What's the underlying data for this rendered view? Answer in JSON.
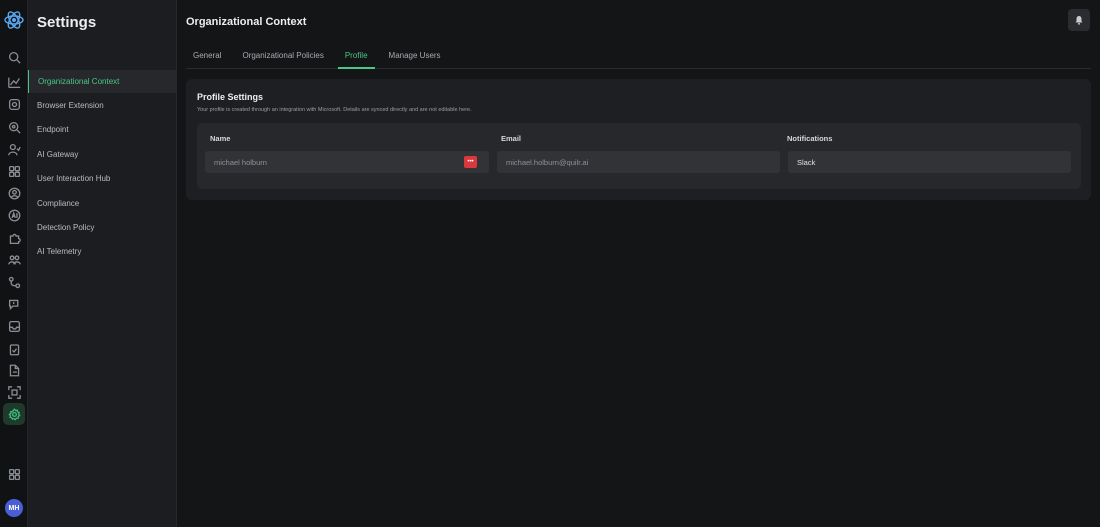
{
  "rail": {
    "avatar_initials": "MH",
    "accent_color": "#3fbf7a"
  },
  "sidebar": {
    "title": "Settings",
    "items": [
      {
        "label": "Organizational Context",
        "active": true
      },
      {
        "label": "Browser Extension"
      },
      {
        "label": "Endpoint"
      },
      {
        "label": "AI Gateway"
      },
      {
        "label": "User Interaction Hub"
      },
      {
        "label": "Compliance"
      },
      {
        "label": "Detection Policy"
      },
      {
        "label": "AI Telemetry"
      }
    ]
  },
  "header": {
    "title": "Organizational Context"
  },
  "tabs": [
    {
      "label": "General"
    },
    {
      "label": "Organizational Policies"
    },
    {
      "label": "Profile",
      "active": true
    },
    {
      "label": "Manage Users"
    }
  ],
  "profile": {
    "title": "Profile Settings",
    "subtitle": "Your profile is created through an integration with Microsoft. Details are synced directly and are not editable here.",
    "name_label": "Name",
    "name_value": "michael holburn",
    "email_label": "Email",
    "email_value": "michael.holburn@quilr.ai",
    "notifications_label": "Notifications",
    "notifications_value": "Slack",
    "password_badge": "•••"
  }
}
